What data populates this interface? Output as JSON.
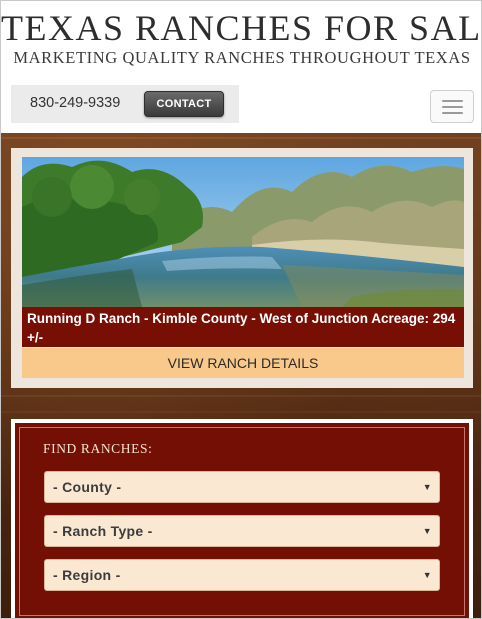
{
  "header": {
    "title": "TEXAS RANCHES FOR SALE",
    "tagline": "MARKETING QUALITY RANCHES THROUGHOUT TEXAS",
    "phone": "830-249-9339",
    "contact_label": "CONTACT",
    "menu_icon": "hamburger-menu-icon"
  },
  "featured": {
    "caption": "Running D Ranch - Kimble County - West of Junction  Acreage: 294 +/-",
    "button_label": "VIEW RANCH DETAILS"
  },
  "search": {
    "title": "FIND RANCHES:",
    "selects": [
      {
        "value": "- County -"
      },
      {
        "value": "- Ranch Type -"
      },
      {
        "value": "- Region -"
      }
    ],
    "arrow_glyph": "▼"
  },
  "colors": {
    "caption_bg": "#770f05",
    "button_bg": "#f8c98a",
    "panel_bg": "#740f06",
    "select_bg": "#fbe8d3"
  }
}
